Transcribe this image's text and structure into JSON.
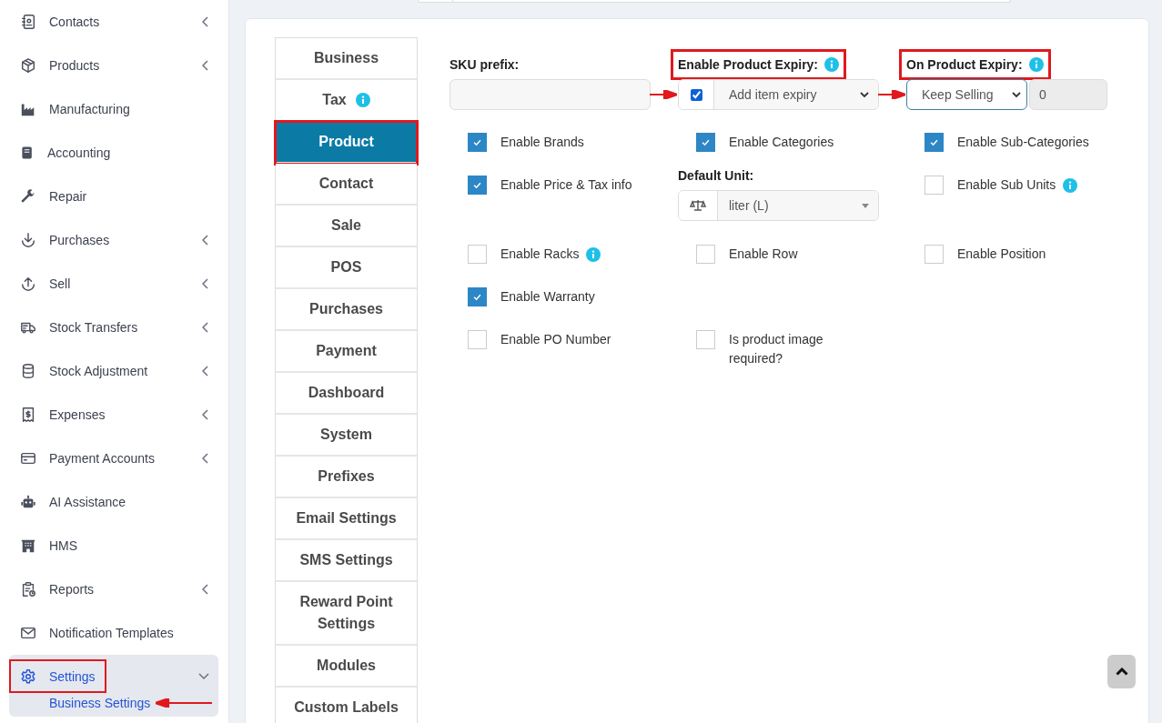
{
  "sidebar": {
    "items": [
      {
        "label": "Contacts",
        "expandable": true,
        "expanded": false,
        "selected": false,
        "highlighted": false
      },
      {
        "label": "Products",
        "expandable": true,
        "expanded": false,
        "selected": false,
        "highlighted": false
      },
      {
        "label": "Manufacturing",
        "expandable": false,
        "expanded": false,
        "selected": false,
        "highlighted": false
      },
      {
        "label": "Accounting",
        "expandable": false,
        "expanded": false,
        "selected": false,
        "highlighted": false
      },
      {
        "label": "Repair",
        "expandable": false,
        "expanded": false,
        "selected": false,
        "highlighted": false
      },
      {
        "label": "Purchases",
        "expandable": true,
        "expanded": false,
        "selected": false,
        "highlighted": false
      },
      {
        "label": "Sell",
        "expandable": true,
        "expanded": false,
        "selected": false,
        "highlighted": false
      },
      {
        "label": "Stock Transfers",
        "expandable": true,
        "expanded": false,
        "selected": false,
        "highlighted": false
      },
      {
        "label": "Stock Adjustment",
        "expandable": true,
        "expanded": false,
        "selected": false,
        "highlighted": false
      },
      {
        "label": "Expenses",
        "expandable": true,
        "expanded": false,
        "selected": false,
        "highlighted": false
      },
      {
        "label": "Payment Accounts",
        "expandable": true,
        "expanded": false,
        "selected": false,
        "highlighted": false
      },
      {
        "label": "AI Assistance",
        "expandable": false,
        "expanded": false,
        "selected": false,
        "highlighted": false
      },
      {
        "label": "HMS",
        "expandable": false,
        "expanded": false,
        "selected": false,
        "highlighted": false
      },
      {
        "label": "Reports",
        "expandable": true,
        "expanded": false,
        "selected": false,
        "highlighted": false
      },
      {
        "label": "Notification Templates",
        "expandable": false,
        "expanded": false,
        "selected": false,
        "highlighted": false
      },
      {
        "label": "Settings",
        "expandable": true,
        "expanded": true,
        "selected": true,
        "highlighted": true,
        "children": [
          {
            "label": "Business Settings",
            "selected": true,
            "arrow": true
          }
        ]
      }
    ]
  },
  "tabs": [
    {
      "label": "Business",
      "selected": false,
      "info": false
    },
    {
      "label": "Tax",
      "selected": false,
      "info": true
    },
    {
      "label": "Product",
      "selected": true,
      "info": false
    },
    {
      "label": "Contact",
      "selected": false,
      "info": false
    },
    {
      "label": "Sale",
      "selected": false,
      "info": false
    },
    {
      "label": "POS",
      "selected": false,
      "info": false
    },
    {
      "label": "Purchases",
      "selected": false,
      "info": false
    },
    {
      "label": "Payment",
      "selected": false,
      "info": false
    },
    {
      "label": "Dashboard",
      "selected": false,
      "info": false
    },
    {
      "label": "System",
      "selected": false,
      "info": false
    },
    {
      "label": "Prefixes",
      "selected": false,
      "info": false
    },
    {
      "label": "Email Settings",
      "selected": false,
      "info": false
    },
    {
      "label": "SMS Settings",
      "selected": false,
      "info": false
    },
    {
      "label": "Reward Point Settings",
      "selected": false,
      "info": false
    },
    {
      "label": "Modules",
      "selected": false,
      "info": false
    },
    {
      "label": "Custom Labels",
      "selected": false,
      "info": false
    }
  ],
  "form": {
    "rows": [
      [
        {
          "kind": "text",
          "label": "SKU prefix:"
        },
        {
          "kind": "check-select",
          "label": "Enable Product Expiry:",
          "info": true,
          "highlighted": true,
          "arrow": true,
          "checked": true,
          "value": "Add item expiry"
        },
        {
          "kind": "select-number",
          "label": "On Product Expiry:",
          "info": true,
          "highlighted": true,
          "arrow": true,
          "value": "Keep Selling",
          "number": "0"
        }
      ],
      [
        {
          "kind": "checkbox",
          "label": "Enable Brands",
          "checked": true,
          "info": false
        },
        {
          "kind": "checkbox",
          "label": "Enable Categories",
          "checked": true,
          "info": false
        },
        {
          "kind": "checkbox",
          "label": "Enable Sub-Categories",
          "checked": true,
          "info": false
        }
      ],
      [
        {
          "kind": "checkbox",
          "label": "Enable Price & Tax info",
          "checked": true,
          "info": false
        },
        {
          "kind": "unit-select",
          "label": "Default Unit:",
          "value": "liter (L)"
        },
        {
          "kind": "checkbox",
          "label": "Enable Sub Units",
          "checked": false,
          "info": true
        }
      ],
      [
        {
          "kind": "checkbox",
          "label": "Enable Racks",
          "checked": false,
          "info": true
        },
        {
          "kind": "checkbox",
          "label": "Enable Row",
          "checked": false,
          "info": false
        },
        {
          "kind": "checkbox",
          "label": "Enable Position",
          "checked": false,
          "info": false
        }
      ],
      [
        {
          "kind": "checkbox",
          "label": "Enable Warranty",
          "checked": true,
          "info": false
        }
      ],
      [
        {
          "kind": "checkbox",
          "label": "Enable PO Number",
          "checked": false,
          "info": false
        },
        {
          "kind": "checkbox",
          "label": "Is product image required?",
          "checked": false,
          "info": false
        }
      ]
    ]
  }
}
